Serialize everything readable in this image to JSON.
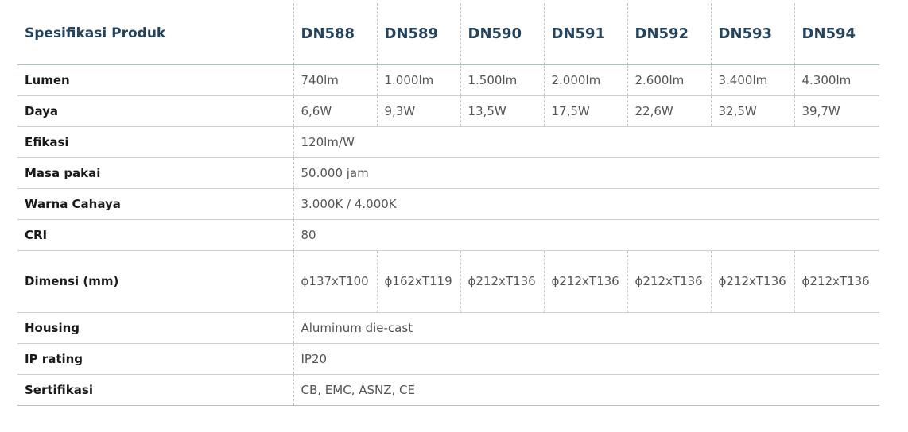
{
  "table": {
    "title": "Spesifikasi Produk",
    "models": [
      "DN588",
      "DN589",
      "DN590",
      "DN591",
      "DN592",
      "DN593",
      "DN594"
    ],
    "rows": {
      "lumen": {
        "label": "Lumen",
        "values": [
          "740lm",
          "1.000lm",
          "1.500lm",
          "2.000lm",
          "2.600lm",
          "3.400lm",
          "4.300lm"
        ]
      },
      "daya": {
        "label": "Daya",
        "values": [
          "6,6W",
          "9,3W",
          "13,5W",
          "17,5W",
          "22,6W",
          "32,5W",
          "39,7W"
        ]
      },
      "efikasi": {
        "label": "Efikasi",
        "value": "120lm/W"
      },
      "masa_pakai": {
        "label": "Masa pakai",
        "value": "50.000 jam"
      },
      "warna_cahaya": {
        "label": "Warna Cahaya",
        "value": "3.000K / 4.000K"
      },
      "cri": {
        "label": "CRI",
        "value": "80"
      },
      "dimensi": {
        "label": "Dimensi (mm)",
        "values": [
          "ϕ137xT100",
          "ϕ162xT119",
          "ϕ212xT136",
          "ϕ212xT136",
          "ϕ212xT136",
          "ϕ212xT136",
          "ϕ212xT136"
        ]
      },
      "housing": {
        "label": "Housing",
        "value": "Aluminum die-cast"
      },
      "ip_rating": {
        "label": "IP rating",
        "value": "IP20"
      },
      "sertifikasi": {
        "label": "Sertifikasi",
        "value": "CB, EMC, ASNZ, CE"
      }
    }
  }
}
